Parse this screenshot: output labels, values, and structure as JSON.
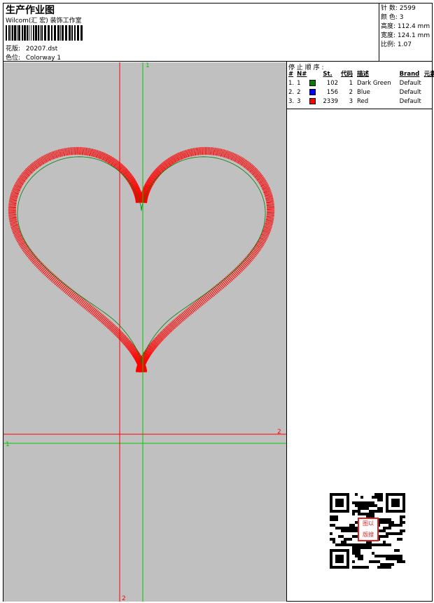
{
  "header": {
    "title": "生产作业图",
    "company": "Wilcom(汇 宏) 装饰工作室",
    "design_label": "花版:",
    "design_value": "20207.dst",
    "colorway_label": "色位:",
    "colorway_value": "Colorway 1"
  },
  "stats": [
    {
      "label": "针 数:",
      "value": "2599"
    },
    {
      "label": "颜 色:",
      "value": "3"
    },
    {
      "label": "高度:",
      "value": "112.4 mm"
    },
    {
      "label": "宽度:",
      "value": "124.1 mm"
    },
    {
      "label": "比例:",
      "value": "1.07"
    }
  ],
  "stop_sequence": {
    "title": "停 止 顺 序 :",
    "columns": [
      "#",
      "N#",
      "",
      "St.",
      "代码",
      "描述",
      "Brand",
      "元素"
    ],
    "rows": [
      {
        "num": "1.",
        "n": "1",
        "color": "#008000",
        "st": "102",
        "code": "1",
        "desc": "Dark Green",
        "brand": "Default"
      },
      {
        "num": "2.",
        "n": "2",
        "color": "#0000ff",
        "st": "156",
        "code": "2",
        "desc": "Blue",
        "brand": "Default"
      },
      {
        "num": "3.",
        "n": "3",
        "color": "#ff0000",
        "st": "2339",
        "code": "3",
        "desc": "Red",
        "brand": "Default"
      }
    ]
  },
  "axes": {
    "green_v_label": "1",
    "green_h_label": "1",
    "red_h_label": "2",
    "red_v_label": "2"
  },
  "qr": {
    "stamp_text": [
      "以",
      "图",
      "搜",
      "版"
    ]
  },
  "colors": {
    "background": "#c0c0c0",
    "green": "#00cc00",
    "red": "#ff0000",
    "stitch_green": "#008000"
  }
}
